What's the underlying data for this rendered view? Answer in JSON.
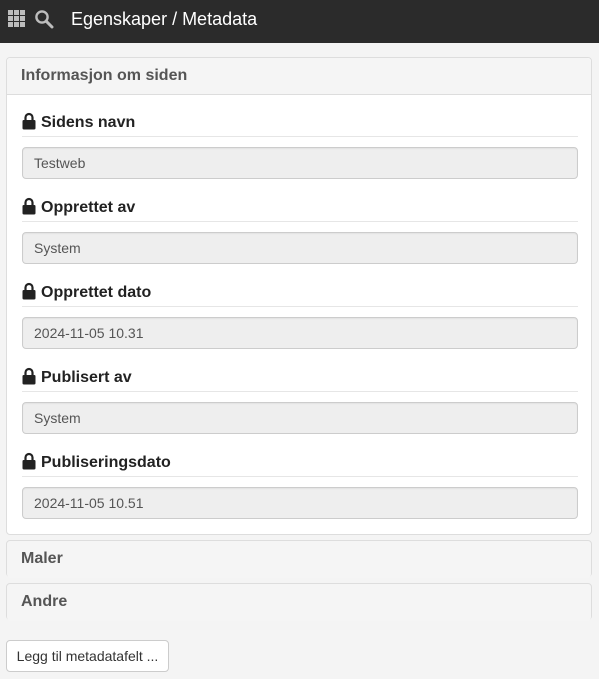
{
  "topbar": {
    "apps_icon": "grid-icon",
    "search_icon": "search-icon",
    "title": "Egenskaper / Metadata"
  },
  "info_panel": {
    "heading": "Informasjon om siden",
    "fields": [
      {
        "label": "Sidens navn",
        "value": "Testweb",
        "icon": "lock-icon"
      },
      {
        "label": "Opprettet av",
        "value": "System",
        "icon": "lock-icon"
      },
      {
        "label": "Opprettet dato",
        "value": "2024-11-05 10.31",
        "icon": "lock-icon"
      },
      {
        "label": "Publisert av",
        "value": "System",
        "icon": "lock-icon"
      },
      {
        "label": "Publiseringsdato",
        "value": "2024-11-05 10.51",
        "icon": "lock-icon"
      }
    ]
  },
  "templates_panel": {
    "heading": "Maler"
  },
  "other_panel": {
    "heading": "Andre"
  },
  "add_button": {
    "label": "Legg til metadatafelt ..."
  },
  "colors": {
    "topbar": "#2b2b2b",
    "panel_heading": "#f5f5f5",
    "input_readonly": "#eeeeee"
  }
}
